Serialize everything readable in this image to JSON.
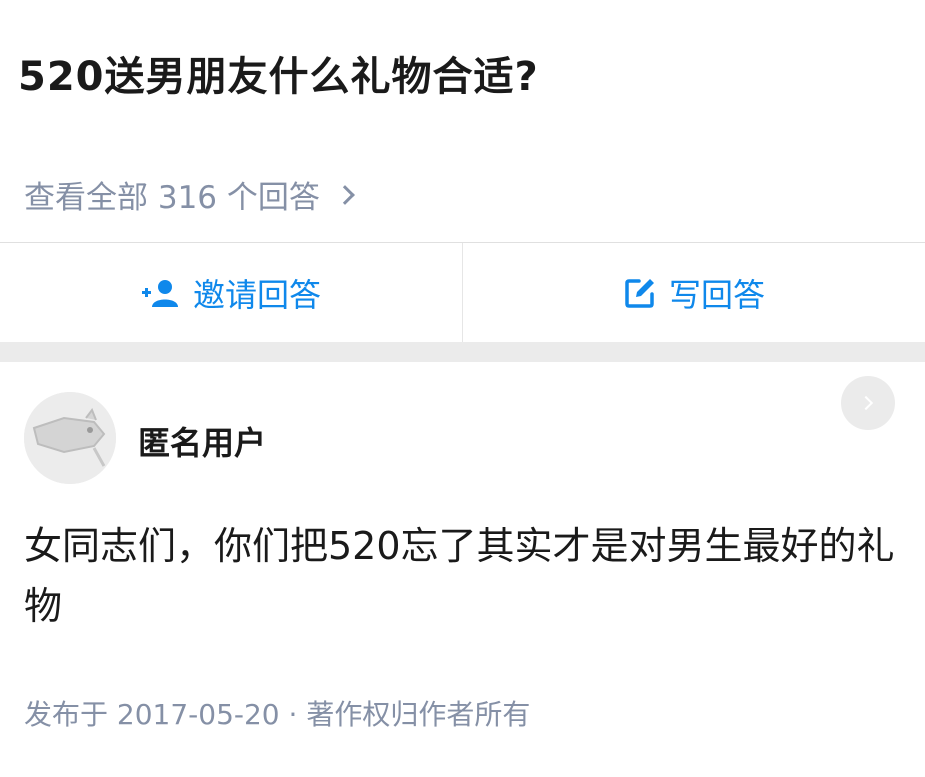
{
  "question": {
    "title": "520送男朋友什么礼物合适?",
    "view_all": "查看全部 316 个回答"
  },
  "actions": {
    "invite_label": "邀请回答",
    "write_label": "写回答"
  },
  "answer": {
    "author": "匿名用户",
    "content": "女同志们，你们把520忘了其实才是对男生最好的礼物",
    "meta": "发布于 2017-05-20 · 著作权归作者所有"
  },
  "icons": {
    "invite": "add-user-icon",
    "write": "edit-icon",
    "more": "chevron-right-icon",
    "view_all": "chevron-right-icon"
  },
  "colors": {
    "accent": "#0f88eb",
    "muted": "#8590a6",
    "text": "#1a1a1a",
    "divider": "#ebebeb"
  }
}
